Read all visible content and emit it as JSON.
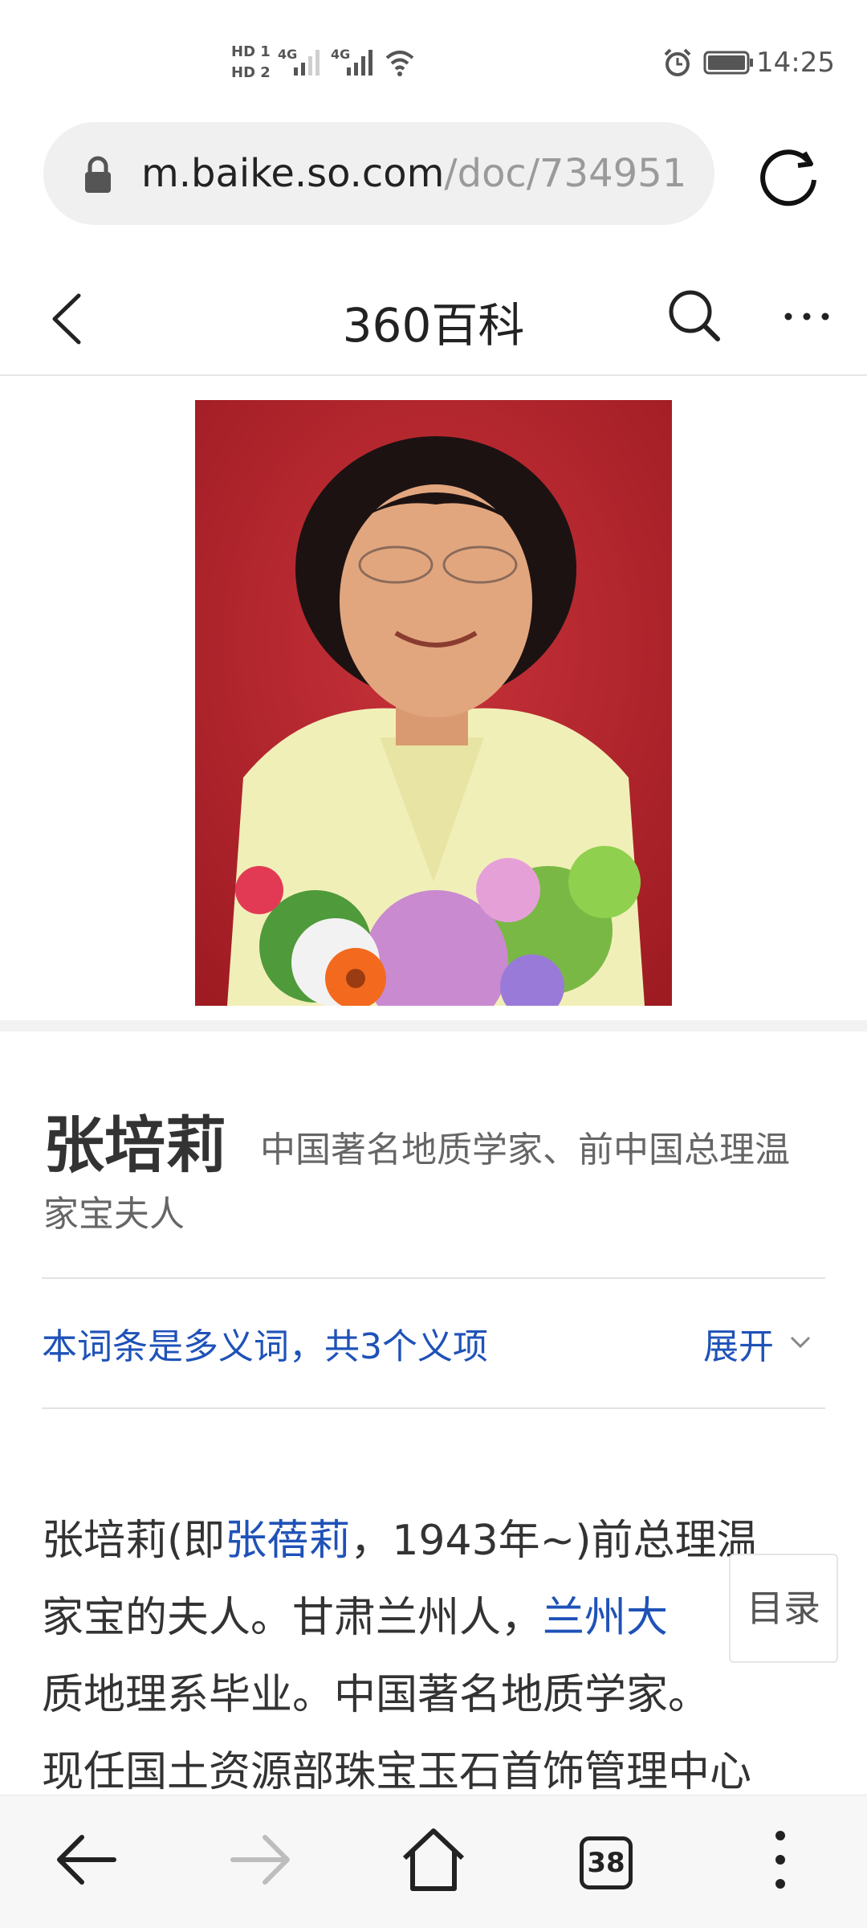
{
  "status_bar": {
    "hd1": "HD 1",
    "hd2": "HD 2",
    "net1": "4G",
    "net2": "4G",
    "time": "14:25"
  },
  "browser": {
    "url_host": "m.baike.so.com",
    "url_path": "/doc/734951"
  },
  "header": {
    "title": "360百科"
  },
  "entry": {
    "title": "张培莉",
    "description": "中国著名地质学家、前中国总理温家宝夫人",
    "polysemy_text": "本词条是多义词，共3个义项",
    "expand_label": "展开"
  },
  "body": {
    "line1_a": "张培莉(即",
    "line1_link": "张蓓莉",
    "line1_b": "，1943年~)前总理温",
    "line2_a": "家宝的夫人。甘肃兰州人，",
    "line2_link": "兰州大",
    "line3": "质地理系毕业。中国著名地质学家。",
    "line4": "现任国土资源部珠宝玉石首饰管理中心"
  },
  "toc": {
    "label": "目录"
  },
  "bottom_nav": {
    "tabs_count": "38"
  },
  "colors": {
    "link": "#1f52b8",
    "portrait_bg": "#b7242a"
  }
}
